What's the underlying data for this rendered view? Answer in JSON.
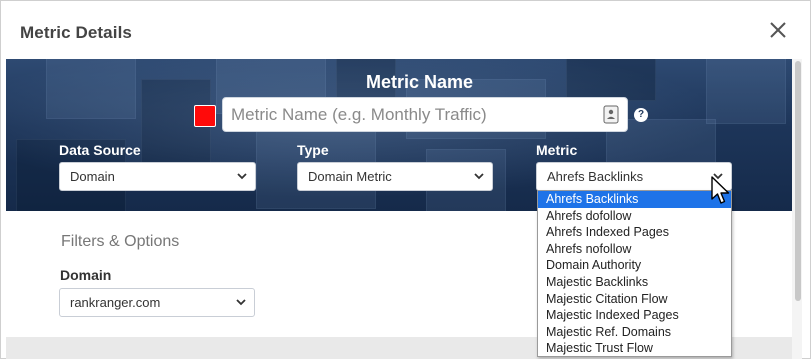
{
  "modal": {
    "title": "Metric Details"
  },
  "hero": {
    "title": "Metric Name",
    "name_placeholder": "Metric Name (e.g. Monthly Traffic)",
    "swatch_color": "#ff0a0a",
    "help": "?"
  },
  "fields": {
    "data_source": {
      "label": "Data Source",
      "value": "Domain"
    },
    "type": {
      "label": "Type",
      "value": "Domain Metric"
    },
    "metric": {
      "label": "Metric",
      "value": "Ahrefs Backlinks"
    }
  },
  "metric_options": [
    "Ahrefs Backlinks",
    "Ahrefs dofollow",
    "Ahrefs Indexed Pages",
    "Ahrefs nofollow",
    "Domain Authority",
    "Majestic Backlinks",
    "Majestic Citation Flow",
    "Majestic Indexed Pages",
    "Majestic Ref. Domains",
    "Majestic Trust Flow"
  ],
  "metric_selected_index": 0,
  "filters": {
    "title": "Filters & Options",
    "domain_label": "Domain",
    "domain_value": "rankranger.com"
  },
  "colors": {
    "hero_bg": "#1d3559",
    "selected_option": "#1e73e8"
  }
}
